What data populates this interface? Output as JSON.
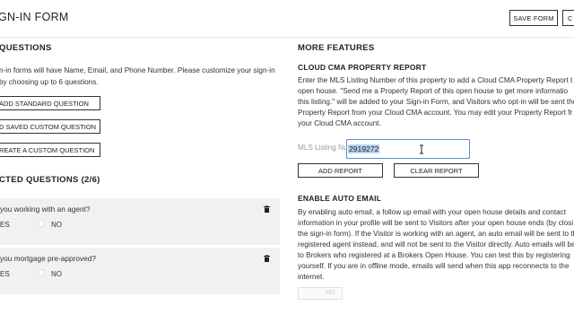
{
  "header": {
    "title": "/ SIGN-IN FORM",
    "save_label": "SAVE FORM",
    "second_label": "C"
  },
  "left": {
    "questions_heading": "QUESTIONS",
    "intro_line1": "n-in forms will have Name, Email, and Phone Number. Please customize your sign-in",
    "intro_line2": "by choosing up to 6 questions.",
    "add_standard_label": "ADD STANDARD QUESTION",
    "add_saved_label": "D SAVED CUSTOM QUESTION",
    "create_custom_label": "REATE A CUSTOM QUESTION",
    "selected_heading": "CTED QUESTIONS (2/6)",
    "questions": [
      {
        "text": "you working with an agent?",
        "yes": "ES",
        "no": "NO"
      },
      {
        "text": "you mortgage pre-approved?",
        "yes": "ES",
        "no": "NO"
      }
    ]
  },
  "right": {
    "more_heading": "MORE FEATURES",
    "cma_heading": "CLOUD CMA PROPERTY REPORT",
    "cma_lines": [
      "Enter the MLS Listing Number of this property to add a Cloud CMA Property Report t",
      "open house. \"Send me a Property Report of this open house to get more informatio",
      "this listing.\" will be added to your Sign-in Form, and Visitors who opt-in will be sent the",
      "Property Report from your Cloud CMA account. You may edit your Property Report fr",
      "your Cloud CMA account."
    ],
    "mls_label": "MLS Listing Number",
    "mls_value": "2919272",
    "add_report_label": "ADD REPORT",
    "clear_report_label": "CLEAR REPORT",
    "auto_heading": "ENABLE AUTO EMAIL",
    "auto_lines": [
      "By enabling auto email, a follow up email with your open house details and contact",
      "information in your profile will be sent to Visitors after your open house ends (by closi",
      "the sign-in form). If the Visitor is working with an agent, an auto email will be sent to th",
      "registered agent instead, and will not be sent to the Visitor directly. Auto emails will be",
      "to Brokers who registered at a Brokers Open House. You can test this by registering",
      "yourself. If you are in offline mode, emails will send when this app reconnects to the",
      "internet."
    ],
    "toggle_label": "NO"
  },
  "icons": {
    "trash": "trash-icon",
    "cursor": "text-cursor-icon"
  },
  "colors": {
    "card_bg": "#f1f1f1",
    "input_border": "#5b8fd6",
    "selection": "#b7d2f3"
  }
}
